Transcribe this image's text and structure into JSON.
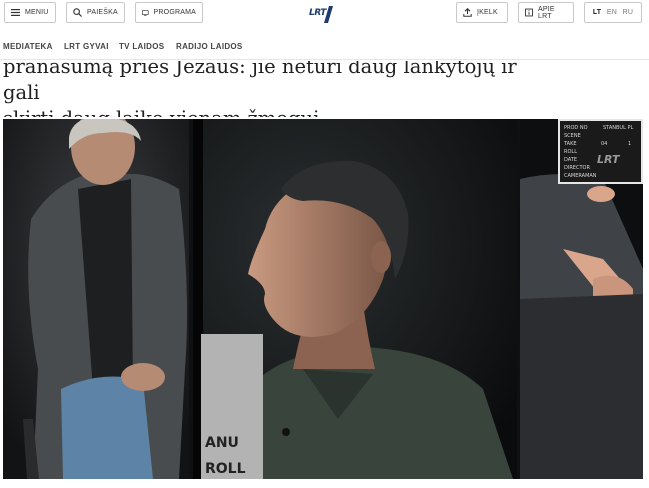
{
  "header": {
    "menu_label": "MENIU",
    "search_label": "PAIEŠKA",
    "program_label": "PROGRAMA",
    "logo_text": "LRT",
    "upload_label": "ĮKELK",
    "about_label": "APIE LRT",
    "languages": [
      "LT",
      "EN",
      "RU"
    ]
  },
  "nav": {
    "items": [
      "MEDIATEKA",
      "LRT GYVAI",
      "TV LAIDOS",
      "RADIJO LAIDOS"
    ]
  },
  "article": {
    "headline_line1": "pranašumą prieš Jėzaus: jie neturi daug lankytojų ir gali",
    "headline_line2": "skirti daug laiko vienam žmogui"
  },
  "image": {
    "clapper_lines": [
      "PROD NO",
      "SCENE",
      "TAKE",
      "ROLL",
      "DATE",
      "DIRECTOR",
      "CAMERAMAN"
    ],
    "clapper_values": [
      "STANBUL PL",
      "04",
      "1"
    ],
    "clapper_brand": "LRT",
    "board_fragment": [
      "ANU",
      "ROLL"
    ]
  },
  "colors": {
    "brand": "#1d3b6e",
    "border": "#c9c9c9",
    "photo_bg": "#0f1012"
  }
}
